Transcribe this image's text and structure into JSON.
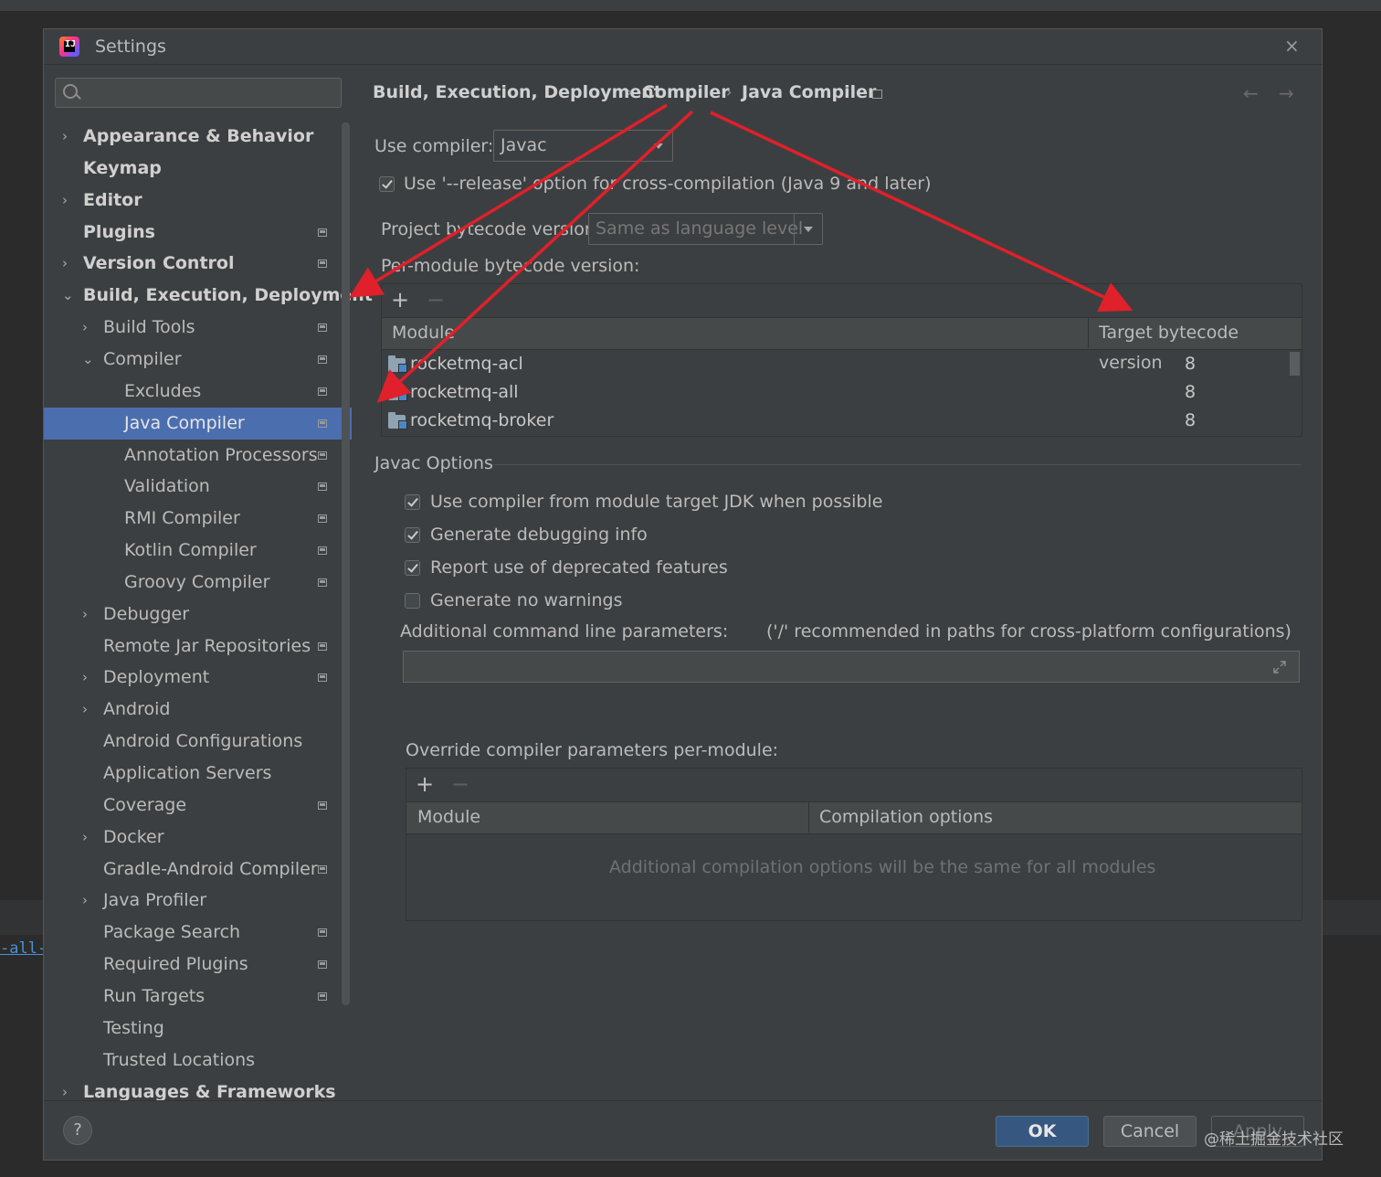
{
  "background": {
    "code_snippet": "-all-"
  },
  "window": {
    "title": "Settings",
    "close_glyph": "×"
  },
  "search": {
    "placeholder": ""
  },
  "sidebar": {
    "items": [
      {
        "label": "Appearance & Behavior",
        "level": 0,
        "arrow": "›",
        "bold": true,
        "pin": false
      },
      {
        "label": "Keymap",
        "level": 0,
        "arrow": "",
        "bold": true,
        "pin": false
      },
      {
        "label": "Editor",
        "level": 0,
        "arrow": "›",
        "bold": true,
        "pin": false
      },
      {
        "label": "Plugins",
        "level": 0,
        "arrow": "",
        "bold": true,
        "pin": true
      },
      {
        "label": "Version Control",
        "level": 0,
        "arrow": "›",
        "bold": true,
        "pin": true
      },
      {
        "label": "Build, Execution, Deployment",
        "level": 0,
        "arrow": "⌄",
        "bold": true,
        "pin": false
      },
      {
        "label": "Build Tools",
        "level": 1,
        "arrow": "›",
        "bold": false,
        "pin": true
      },
      {
        "label": "Compiler",
        "level": 1,
        "arrow": "⌄",
        "bold": false,
        "pin": true
      },
      {
        "label": "Excludes",
        "level": 2,
        "arrow": "",
        "bold": false,
        "pin": true
      },
      {
        "label": "Java Compiler",
        "level": 2,
        "arrow": "",
        "bold": false,
        "pin": true,
        "selected": true
      },
      {
        "label": "Annotation Processors",
        "level": 2,
        "arrow": "",
        "bold": false,
        "pin": true
      },
      {
        "label": "Validation",
        "level": 2,
        "arrow": "",
        "bold": false,
        "pin": true
      },
      {
        "label": "RMI Compiler",
        "level": 2,
        "arrow": "",
        "bold": false,
        "pin": true
      },
      {
        "label": "Kotlin Compiler",
        "level": 2,
        "arrow": "",
        "bold": false,
        "pin": true
      },
      {
        "label": "Groovy Compiler",
        "level": 2,
        "arrow": "",
        "bold": false,
        "pin": true
      },
      {
        "label": "Debugger",
        "level": 1,
        "arrow": "›",
        "bold": false,
        "pin": false
      },
      {
        "label": "Remote Jar Repositories",
        "level": 1,
        "arrow": "",
        "bold": false,
        "pin": true
      },
      {
        "label": "Deployment",
        "level": 1,
        "arrow": "›",
        "bold": false,
        "pin": true
      },
      {
        "label": "Android",
        "level": 1,
        "arrow": "›",
        "bold": false,
        "pin": false
      },
      {
        "label": "Android Configurations",
        "level": 1,
        "arrow": "",
        "bold": false,
        "pin": false
      },
      {
        "label": "Application Servers",
        "level": 1,
        "arrow": "",
        "bold": false,
        "pin": false
      },
      {
        "label": "Coverage",
        "level": 1,
        "arrow": "",
        "bold": false,
        "pin": true
      },
      {
        "label": "Docker",
        "level": 1,
        "arrow": "›",
        "bold": false,
        "pin": false
      },
      {
        "label": "Gradle-Android Compiler",
        "level": 1,
        "arrow": "",
        "bold": false,
        "pin": true
      },
      {
        "label": "Java Profiler",
        "level": 1,
        "arrow": "›",
        "bold": false,
        "pin": false
      },
      {
        "label": "Package Search",
        "level": 1,
        "arrow": "",
        "bold": false,
        "pin": true
      },
      {
        "label": "Required Plugins",
        "level": 1,
        "arrow": "",
        "bold": false,
        "pin": true
      },
      {
        "label": "Run Targets",
        "level": 1,
        "arrow": "",
        "bold": false,
        "pin": true
      },
      {
        "label": "Testing",
        "level": 1,
        "arrow": "",
        "bold": false,
        "pin": false
      },
      {
        "label": "Trusted Locations",
        "level": 1,
        "arrow": "",
        "bold": false,
        "pin": false
      },
      {
        "label": "Languages & Frameworks",
        "level": 0,
        "arrow": "›",
        "bold": true,
        "pin": false
      }
    ]
  },
  "breadcrumb": {
    "items": [
      "Build, Execution, Deployment",
      "Compiler",
      "Java Compiler"
    ],
    "separator": "›",
    "back_glyph": "←",
    "forward_glyph": "→"
  },
  "compiler": {
    "use_compiler_label": "Use compiler:",
    "use_compiler_value": "Javac",
    "release_option_label": "Use '--release' option for cross-compilation (Java 9 and later)",
    "release_option_checked": true,
    "bytecode_label": "Project bytecode version:",
    "bytecode_value": "Same as language level",
    "per_module_label": "Per-module bytecode version:"
  },
  "module_table": {
    "plus": "+",
    "minus": "−",
    "columns": [
      "Module",
      "Target bytecode version"
    ],
    "rows": [
      {
        "module": "rocketmq-acl",
        "version": "8"
      },
      {
        "module": "rocketmq-all",
        "version": "8"
      },
      {
        "module": "rocketmq-broker",
        "version": "8"
      }
    ]
  },
  "javac_options": {
    "section_title": "Javac Options",
    "checkboxes": [
      {
        "label": "Use compiler from module target JDK when possible",
        "checked": true
      },
      {
        "label": "Generate debugging info",
        "checked": true
      },
      {
        "label": "Report use of deprecated features",
        "checked": true
      },
      {
        "label": "Generate no warnings",
        "checked": false
      }
    ],
    "additional_params_label": "Additional command line parameters:",
    "additional_params_hint": "('/' recommended in paths for cross-platform configurations)",
    "additional_params_value": ""
  },
  "override": {
    "label": "Override compiler parameters per-module:",
    "plus": "+",
    "minus": "−",
    "columns": [
      "Module",
      "Compilation options"
    ],
    "empty_text": "Additional compilation options will be the same for all modules"
  },
  "buttons": {
    "help": "?",
    "ok": "OK",
    "cancel": "Cancel",
    "apply": "Apply"
  },
  "watermark": "@稀土掘金技术社区",
  "colors": {
    "accent_selection": "#4b6eaf",
    "ok_button": "#365880",
    "annotation_arrow": "#e0202a"
  }
}
